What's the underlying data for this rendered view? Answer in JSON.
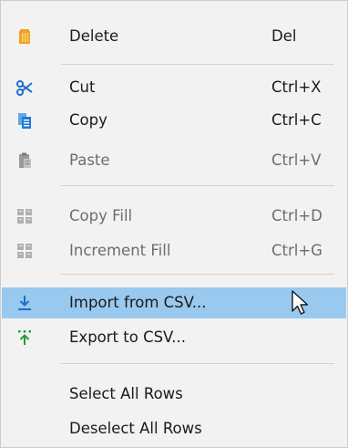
{
  "menu": {
    "items": {
      "delete": {
        "label": "Delete",
        "shortcut": "Del",
        "icon": "trash-icon",
        "enabled": true
      },
      "cut": {
        "label": "Cut",
        "shortcut": "Ctrl+X",
        "icon": "scissors-icon",
        "enabled": true
      },
      "copy": {
        "label": "Copy",
        "shortcut": "Ctrl+C",
        "icon": "copy-icon",
        "enabled": true
      },
      "paste": {
        "label": "Paste",
        "shortcut": "Ctrl+V",
        "icon": "paste-icon",
        "enabled": false
      },
      "copy_fill": {
        "label": "Copy Fill",
        "shortcut": "Ctrl+D",
        "icon": "copy-fill-icon",
        "enabled": false
      },
      "increment_fill": {
        "label": "Increment Fill",
        "shortcut": "Ctrl+G",
        "icon": "increment-fill-icon",
        "enabled": false
      },
      "import_csv": {
        "label": "Import from CSV...",
        "icon": "import-arrow-icon",
        "enabled": true,
        "highlighted": true
      },
      "export_csv": {
        "label": "Export to CSV...",
        "icon": "export-arrow-icon",
        "enabled": true
      },
      "select_all": {
        "label": "Select All Rows",
        "enabled": true
      },
      "deselect_all": {
        "label": "Deselect All Rows",
        "enabled": true
      }
    }
  },
  "colors": {
    "menu_background": "#f2f2f2",
    "highlight": "#99c9ef",
    "trash_orange": "#f0a21a",
    "cut_blue": "#1e6fc8",
    "copy_blue": "#1e7ad6",
    "export_green": "#1f9e3a",
    "disabled_text": "#6d6d6d"
  },
  "cursor": {
    "icon": "mouse-pointer-icon"
  }
}
